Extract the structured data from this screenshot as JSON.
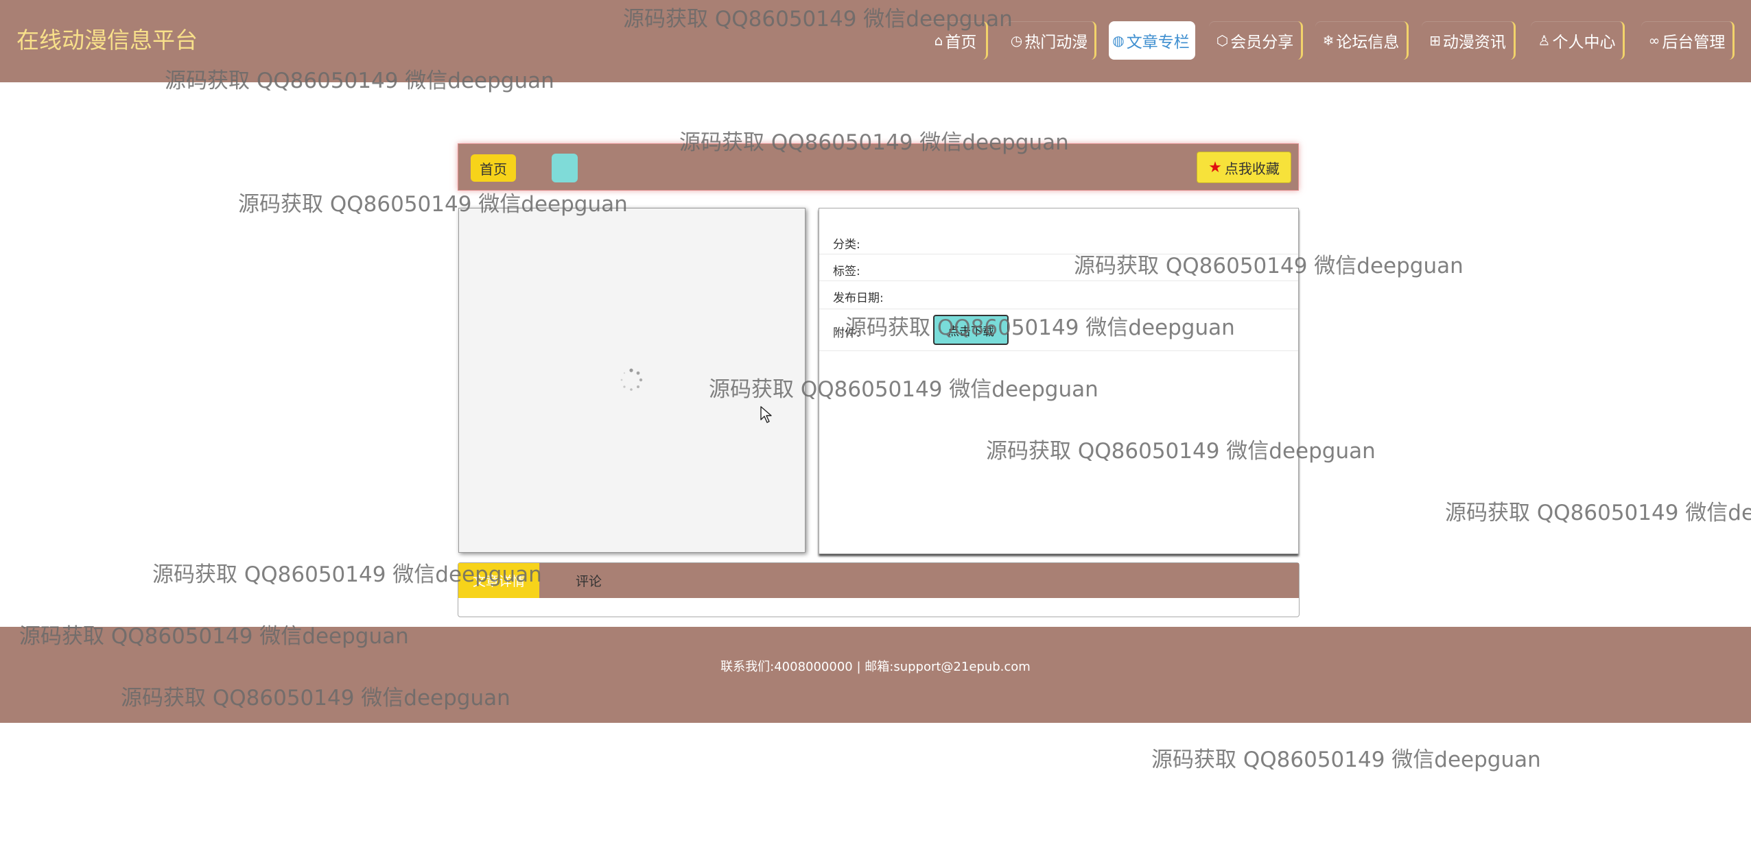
{
  "header": {
    "logo": "在线动漫信息平台",
    "nav": [
      {
        "label": "首页",
        "icon": "home-icon",
        "glyph": "⌂"
      },
      {
        "label": "热门动漫",
        "icon": "clock-icon",
        "glyph": "◷"
      },
      {
        "label": "文章专栏",
        "icon": "globe-icon",
        "glyph": "◍"
      },
      {
        "label": "会员分享",
        "icon": "cube-icon",
        "glyph": "⬡"
      },
      {
        "label": "论坛信息",
        "icon": "snowflake-icon",
        "glyph": "❄"
      },
      {
        "label": "动漫资讯",
        "icon": "book-icon",
        "glyph": "⊞"
      },
      {
        "label": "个人中心",
        "icon": "user-icon",
        "glyph": "♙"
      },
      {
        "label": "后台管理",
        "icon": "link-icon",
        "glyph": "∞"
      }
    ],
    "active_index": 2
  },
  "breadcrumb": {
    "home": "首页",
    "current": ""
  },
  "favorite_button": "点我收藏",
  "info": {
    "category_label": "分类:",
    "tag_label": "标签:",
    "date_label": "发布日期:",
    "attachment_label": "附件:",
    "download_button": "点击下载"
  },
  "tabs": {
    "detail": "文章详情",
    "comment": "评论"
  },
  "footer": {
    "text": "联系我们:4008000000 | 邮箱:support@21epub.com"
  },
  "watermark": "源码获取 QQ86050149 微信deepguan",
  "colors": {
    "brand": "#a98074",
    "accent_yellow": "#f7d31a",
    "accent_teal": "#7fdbd8",
    "logo_text": "#f8e08a"
  }
}
